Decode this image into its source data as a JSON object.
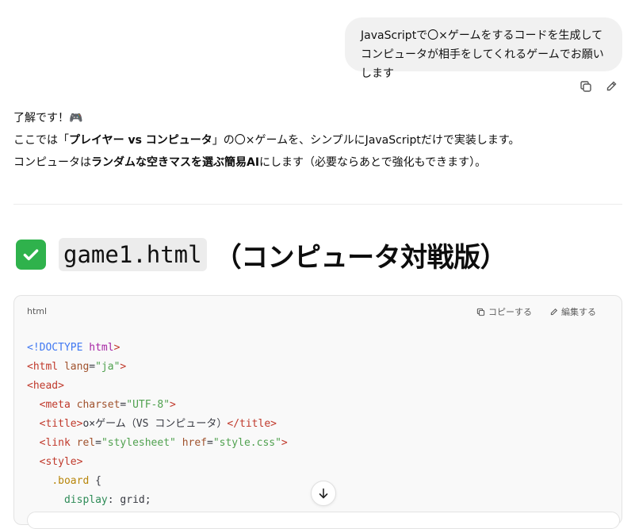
{
  "user_message": {
    "line1": "JavaScriptで〇×ゲームをするコードを生成して",
    "line2": "コンピュータが相手をしてくれるゲームでお願いします"
  },
  "message_actions": {
    "copy_icon": "copy-icon",
    "edit_icon": "pencil-icon"
  },
  "assistant": {
    "line1": "了解です！🎮",
    "line2_a": "ここでは「",
    "line2_b": "プレイヤー vs コンピュータ",
    "line2_c": "」の〇×ゲームを、シンプルにJavaScriptだけで実装します。",
    "line3_a": "コンピュータは",
    "line3_b": "ランダムな空きマスを選ぶ簡易AI",
    "line3_c": "にします（必要ならあとで強化もできます）。"
  },
  "section": {
    "check_icon": "check-mark-icon",
    "code_title": "game1.html",
    "title_suffix": "（コンピュータ対戦版）"
  },
  "code_block": {
    "language": "html",
    "copy_label": "コピーする",
    "edit_label": "編集する",
    "lines": [
      "<!DOCTYPE html>",
      "<html lang=\"ja\">",
      "<head>",
      "  <meta charset=\"UTF-8\">",
      "  <title>o×ゲーム（VS コンピュータ）</title>",
      "  <link rel=\"stylesheet\" href=\"style.css\">",
      "  <style>",
      "    .board {",
      "      display: grid;"
    ]
  },
  "scroll_button_icon": "arrow-down-icon",
  "colors": {
    "check_green": "#2fb24c",
    "bubble_bg": "#f1f1f1",
    "code_bg": "#f9f9f9"
  }
}
